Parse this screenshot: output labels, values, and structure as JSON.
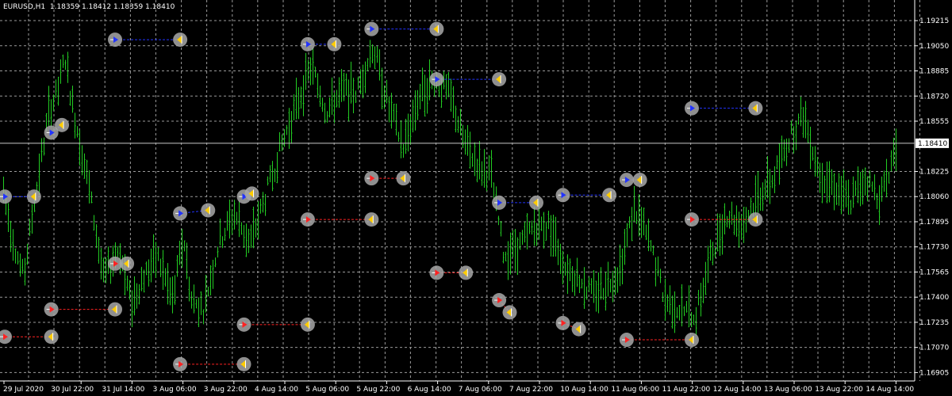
{
  "header": {
    "symbol_tf": "EURUSD,H1",
    "ohlc": "1.18359 1.18412 1.18359 1.18410"
  },
  "colors": {
    "background": "#000000",
    "grid": "#9a9a9a",
    "candle": "#22cc22",
    "axis": "#ffffff",
    "marker_ring": "#a8a8a8",
    "buy_line": "#2233ff",
    "sell_line": "#ff2222",
    "arrow_head": "#ffcc00"
  },
  "chart_data": {
    "type": "line",
    "title": "EURUSD,H1",
    "grid": true,
    "current_price": 1.1841,
    "current_price_label": "1.18410",
    "ylim": [
      1.1685,
      1.1934
    ],
    "y_ticks": [
      {
        "value": 1.16905,
        "label": "1.16905"
      },
      {
        "value": 1.1707,
        "label": "1.17070"
      },
      {
        "value": 1.17235,
        "label": "1.17235"
      },
      {
        "value": 1.174,
        "label": "1.17400"
      },
      {
        "value": 1.17565,
        "label": "1.17565"
      },
      {
        "value": 1.1773,
        "label": "1.17730"
      },
      {
        "value": 1.17895,
        "label": "1.17895"
      },
      {
        "value": 1.1806,
        "label": "1.18060"
      },
      {
        "value": 1.18225,
        "label": "1.18225"
      },
      {
        "value": 1.18555,
        "label": "1.18555"
      },
      {
        "value": 1.1872,
        "label": "1.18720"
      },
      {
        "value": 1.18885,
        "label": "1.18885"
      },
      {
        "value": 1.1905,
        "label": "1.19050"
      },
      {
        "value": 1.19215,
        "label": "1.19215"
      }
    ],
    "x_ticks": [
      "29 Jul 2020",
      "30 Jul 22:00",
      "31 Jul 14:00",
      "3 Aug 06:00",
      "3 Aug 22:00",
      "4 Aug 14:00",
      "5 Aug 06:00",
      "5 Aug 22:00",
      "6 Aug 14:00",
      "7 Aug 06:00",
      "7 Aug 22:00",
      "10 Aug 14:00",
      "11 Aug 06:00",
      "11 Aug 22:00",
      "12 Aug 14:00",
      "13 Aug 06:00",
      "13 Aug 22:00",
      "14 Aug 14:00"
    ],
    "price_path": [
      [
        0,
        1.181
      ],
      [
        0.5,
        1.1783
      ],
      [
        1.3,
        1.1752
      ],
      [
        2,
        1.1803
      ],
      [
        3,
        1.1865
      ],
      [
        3.5,
        1.1873
      ],
      [
        4,
        1.1898
      ],
      [
        4.5,
        1.1865
      ],
      [
        5.5,
        1.1815
      ],
      [
        6.5,
        1.1752
      ],
      [
        7.5,
        1.1773
      ],
      [
        8.3,
        1.1735
      ],
      [
        9,
        1.1752
      ],
      [
        10,
        1.1767
      ],
      [
        11,
        1.1738
      ],
      [
        11.7,
        1.178
      ],
      [
        12.2,
        1.1738
      ],
      [
        13,
        1.1733
      ],
      [
        14,
        1.1776
      ],
      [
        15,
        1.1795
      ],
      [
        16,
        1.1775
      ],
      [
        17,
        1.1805
      ],
      [
        18,
        1.1838
      ],
      [
        19,
        1.1865
      ],
      [
        20,
        1.1892
      ],
      [
        21,
        1.1862
      ],
      [
        22,
        1.1875
      ],
      [
        23,
        1.1875
      ],
      [
        24,
        1.1905
      ],
      [
        25,
        1.1866
      ],
      [
        26,
        1.1838
      ],
      [
        27,
        1.1872
      ],
      [
        28,
        1.1883
      ],
      [
        29,
        1.1873
      ],
      [
        30,
        1.184
      ],
      [
        31,
        1.1825
      ],
      [
        31.7,
        1.182
      ],
      [
        32.5,
        1.1768
      ],
      [
        33.5,
        1.1773
      ],
      [
        34.5,
        1.1787
      ],
      [
        35.5,
        1.1787
      ],
      [
        36.5,
        1.176
      ],
      [
        37.5,
        1.1752
      ],
      [
        38.2,
        1.1742
      ],
      [
        39,
        1.1747
      ],
      [
        40,
        1.1757
      ],
      [
        41,
        1.1799
      ],
      [
        42,
        1.1775
      ],
      [
        43,
        1.1738
      ],
      [
        44,
        1.1732
      ],
      [
        45,
        1.1728
      ],
      [
        46,
        1.1768
      ],
      [
        47,
        1.1795
      ],
      [
        48,
        1.1787
      ],
      [
        49,
        1.1807
      ],
      [
        50,
        1.1817
      ],
      [
        51,
        1.1843
      ],
      [
        52,
        1.186
      ],
      [
        53,
        1.1822
      ],
      [
        54,
        1.1813
      ],
      [
        55,
        1.1802
      ],
      [
        56,
        1.1818
      ],
      [
        57,
        1.1805
      ],
      [
        58,
        1.184
      ]
    ],
    "trades": [
      {
        "type": "buy",
        "open_x": 0,
        "open_price": 1.1806,
        "close_x": 2.2,
        "close_price": 1.1806
      },
      {
        "type": "sell",
        "open_x": 0,
        "open_price": 1.1714,
        "close_x": 3.5,
        "close_price": 1.1714
      },
      {
        "type": "buy",
        "open_x": 3.5,
        "open_price": 1.1848,
        "close_x": 4.3,
        "close_price": 1.1853
      },
      {
        "type": "sell",
        "open_x": 3.5,
        "open_price": 1.1732,
        "close_x": 8.3,
        "close_price": 1.1732
      },
      {
        "type": "buy",
        "open_x": 8.3,
        "open_price": 1.1909,
        "close_x": 13.2,
        "close_price": 1.1909
      },
      {
        "type": "sell",
        "open_x": 8.3,
        "open_price": 1.1762,
        "close_x": 9.2,
        "close_price": 1.1762
      },
      {
        "type": "buy",
        "open_x": 13.2,
        "open_price": 1.1795,
        "close_x": 15.3,
        "close_price": 1.1797
      },
      {
        "type": "sell",
        "open_x": 13.2,
        "open_price": 1.1696,
        "close_x": 18,
        "close_price": 1.1696
      },
      {
        "type": "buy",
        "open_x": 18,
        "open_price": 1.1806,
        "close_x": 18.6,
        "close_price": 1.1808
      },
      {
        "type": "sell",
        "open_x": 18,
        "open_price": 1.1722,
        "close_x": 22.8,
        "close_price": 1.1722
      },
      {
        "type": "buy",
        "open_x": 22.8,
        "open_price": 1.1906,
        "close_x": 24.8,
        "close_price": 1.1906
      },
      {
        "type": "sell",
        "open_x": 22.8,
        "open_price": 1.1791,
        "close_x": 27.6,
        "close_price": 1.1791
      },
      {
        "type": "buy",
        "open_x": 27.6,
        "open_price": 1.1916,
        "close_x": 32.5,
        "close_price": 1.1916
      },
      {
        "type": "sell",
        "open_x": 27.6,
        "open_price": 1.1818,
        "close_x": 30,
        "close_price": 1.1818
      },
      {
        "type": "buy",
        "open_x": 32.5,
        "open_price": 1.1883,
        "close_x": 37.2,
        "close_price": 1.1883
      },
      {
        "type": "sell",
        "open_x": 32.5,
        "open_price": 1.1756,
        "close_x": 34.7,
        "close_price": 1.1756
      },
      {
        "type": "buy",
        "open_x": 37.2,
        "open_price": 1.1802,
        "close_x": 40,
        "close_price": 1.1802
      },
      {
        "type": "sell",
        "open_x": 37.2,
        "open_price": 1.1738,
        "close_x": 38,
        "close_price": 1.173
      },
      {
        "type": "buy",
        "open_x": 42,
        "open_price": 1.1807,
        "close_x": 45.5,
        "close_price": 1.1807
      },
      {
        "type": "sell",
        "open_x": 42,
        "open_price": 1.1723,
        "close_x": 43.2,
        "close_price": 1.1719
      },
      {
        "type": "buy",
        "open_x": 46.8,
        "open_price": 1.1817,
        "close_x": 47.8,
        "close_price": 1.1817
      },
      {
        "type": "sell",
        "open_x": 46.8,
        "open_price": 1.1712,
        "close_x": 51.7,
        "close_price": 1.1712
      },
      {
        "type": "buy",
        "open_x": 51.7,
        "open_price": 1.1864,
        "close_x": 56.5,
        "close_price": 1.1864
      },
      {
        "type": "sell",
        "open_x": 51.7,
        "open_price": 1.1791,
        "close_x": 56.5,
        "close_price": 1.1791
      }
    ]
  }
}
